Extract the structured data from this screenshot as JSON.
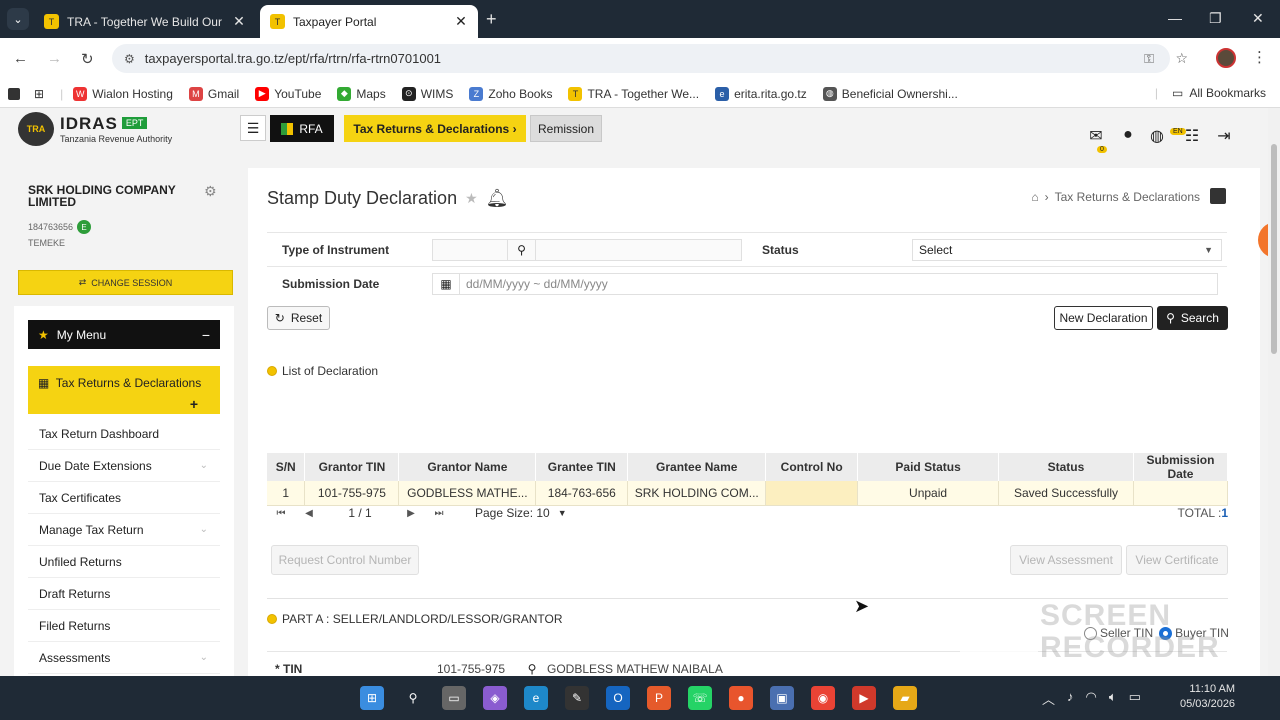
{
  "browser": {
    "tabs": [
      {
        "title": "TRA - Together We Build Our N"
      },
      {
        "title": "Taxpayer Portal"
      }
    ],
    "url": "taxpayersportal.tra.go.tz/ept/rfa/rtrn/rfa-rtrn0701001",
    "bookmarks": [
      "Wialon Hosting",
      "Gmail",
      "YouTube",
      "Maps",
      "WIMS",
      "Zoho Books",
      "TRA - Together We...",
      "erita.rita.go.tz",
      "Beneficial Ownershi..."
    ],
    "all_bookmarks": "All Bookmarks"
  },
  "app": {
    "brand": "IDRAS",
    "brand_badge": "EPT",
    "authority": "Tanzania Revenue Authority",
    "nav": {
      "rfa": "RFA",
      "tax_returns": "Tax Returns & Declarations",
      "remission": "Remission"
    },
    "notif_count": "0",
    "lang": "EN",
    "side_tab": "0I"
  },
  "sidebar": {
    "company": "SRK HOLDING COMPANY LIMITED",
    "tin": "184763656",
    "tin_badge": "E",
    "region": "TEMEKE",
    "change_session": "CHANGE SESSION",
    "my_menu": "My Menu",
    "active_group": "Tax Returns & Declarations",
    "items": [
      {
        "label": "Tax Return Dashboard",
        "chev": false
      },
      {
        "label": "Due Date Extensions",
        "chev": true
      },
      {
        "label": "Tax Certificates",
        "chev": false
      },
      {
        "label": "Manage Tax Return",
        "chev": true
      },
      {
        "label": "Unfiled Returns",
        "chev": false
      },
      {
        "label": "Draft Returns",
        "chev": false
      },
      {
        "label": "Filed Returns",
        "chev": false
      },
      {
        "label": "Assessments",
        "chev": true
      }
    ]
  },
  "page": {
    "title": "Stamp Duty Declaration",
    "breadcrumb": "Tax Returns & Declarations",
    "filters": {
      "type_label": "Type of Instrument",
      "status_label": "Status",
      "status_value": "Select",
      "date_label": "Submission Date",
      "date_placeholder": "dd/MM/yyyy ~ dd/MM/yyyy"
    },
    "buttons": {
      "reset": "Reset",
      "new_declaration": "New Declaration",
      "search": "Search",
      "request_control": "Request Control Number",
      "view_assessment": "View Assessment",
      "view_certificate": "View Certificate"
    },
    "list_title": "List of Declaration",
    "table": {
      "headers": [
        "S/N",
        "Grantor TIN",
        "Grantor Name",
        "Grantee TIN",
        "Grantee Name",
        "Control No",
        "Paid Status",
        "Status",
        "Submission Date"
      ],
      "rows": [
        [
          "1",
          "101-755-975",
          "GODBLESS MATHE...",
          "184-763-656",
          "SRK HOLDING COM...",
          "",
          "Unpaid",
          "Saved Successfully",
          ""
        ]
      ]
    },
    "pager": {
      "page": "1 / 1",
      "page_size": "Page Size: 10",
      "total_label": "TOTAL :",
      "total": "1"
    },
    "radios": {
      "seller": "Seller TIN",
      "buyer": "Buyer TIN",
      "selected": "buyer"
    },
    "part_a": "PART A : SELLER/LANDLORD/LESSOR/GRANTOR",
    "tin_row": {
      "label": "TIN",
      "value": "101-755-975",
      "name": "GODBLESS MATHEW NAIBALA"
    }
  },
  "watermark": "SCREEN RECORDER",
  "taskbar": {
    "time": "11:10 AM",
    "date": "05/03/2026"
  }
}
